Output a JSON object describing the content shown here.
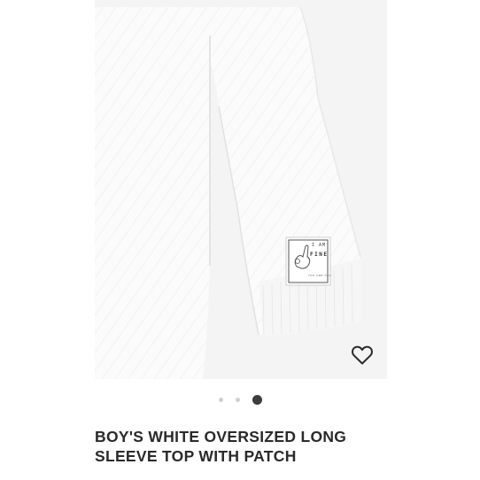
{
  "product": {
    "image_alt": "White quilted long sleeve top with patch",
    "patch": {
      "line1": "I AM",
      "line2": "FINE",
      "line3": "YOU ARE TOO"
    },
    "favorite_icon": "heart-outline-icon",
    "carousel": {
      "total": 3,
      "active_index": 2
    },
    "title_line1": "BOY'S WHITE OVERSIZED LONG",
    "title_line2": "SLEEVE TOP WITH PATCH"
  },
  "colors": {
    "image_bg": "#f4f4f4",
    "garment": "#fafafa",
    "dot_inactive": "#d0d0d0",
    "dot_active": "#3d3d3d",
    "title": "#2a2a2a"
  }
}
